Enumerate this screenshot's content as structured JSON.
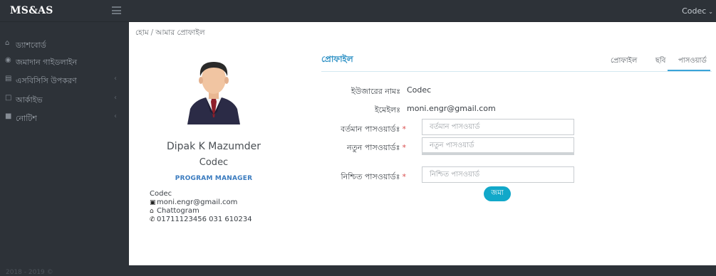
{
  "app": {
    "brand": "MS&AS",
    "user_name": "Codec"
  },
  "sidebar": {
    "items": [
      {
        "label": "ড্যাশবোর্ড",
        "icon": "home-icon",
        "has_arrow": false
      },
      {
        "label": "জমাদান গাইডলাইন",
        "icon": "circle-icon",
        "has_arrow": false
      },
      {
        "label": "এসবিসিসি উপকরণ",
        "icon": "document-icon",
        "has_arrow": true
      },
      {
        "label": "আর্কাইভ",
        "icon": "file-icon",
        "has_arrow": true
      },
      {
        "label": "নোটিশ",
        "icon": "notice-icon",
        "has_arrow": true
      }
    ],
    "footer": "2018 - 2019 ©"
  },
  "breadcrumb": {
    "home": "হোম",
    "separator": "/",
    "current": "আমার প্রোফাইল"
  },
  "profile_card": {
    "full_name": "Dipak K Mazumder",
    "organization": "Codec",
    "role": "PROGRAM MANAGER",
    "contact_org": "Codec",
    "email": "moni.engr@gmail.com",
    "city": "Chattogram",
    "phone": "01711123456 031 610234"
  },
  "profile_panel": {
    "title": "প্রোফাইল",
    "tabs": [
      "প্রোফাইল",
      "ছবি",
      "পাসওয়ার্ড"
    ],
    "active_tab": "পাসওয়ার্ড",
    "username_label": "ইউজারের নামঃ",
    "username_value": "Codec",
    "email_label": "ইমেইলঃ",
    "email_value": "moni.engr@gmail.com",
    "current_pw_label": "বর্তমান পাসওয়ার্ডঃ",
    "current_pw_placeholder": "বর্তমান পাসওয়ার্ড",
    "new_pw_label": "নতুন পাসওয়ার্ডঃ",
    "new_pw_placeholder": "নতুন পাসওয়ার্ড",
    "confirm_pw_label": "নিশ্চিত পাসওয়ার্ডঃ",
    "confirm_pw_placeholder": "নিশ্চিত পাসওয়ার্ড",
    "required_marker": "*",
    "submit_label": "জমা"
  },
  "colors": {
    "sidebar_bg": "#2d3238",
    "accent": "#2a8fc4",
    "submit": "#12a8c9",
    "required": "#d94d4d"
  }
}
